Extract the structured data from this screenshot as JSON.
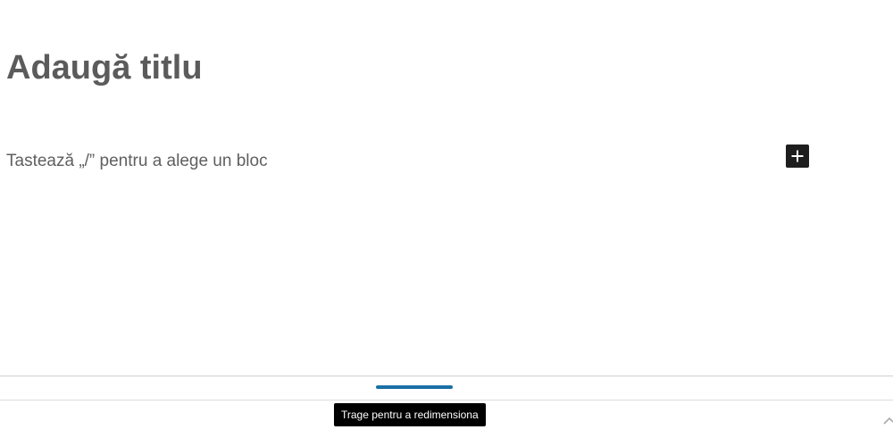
{
  "editor": {
    "title_placeholder": "Adaugă titlu",
    "block_placeholder": "Tastează „/” pentru a alege un bloc",
    "inserter_icon": "plus-icon"
  },
  "resize": {
    "tooltip": "Trage pentru a redimensiona",
    "handle_color": "#1a6fa6"
  },
  "footer": {
    "corner_icon": "chevron-up-icon"
  }
}
